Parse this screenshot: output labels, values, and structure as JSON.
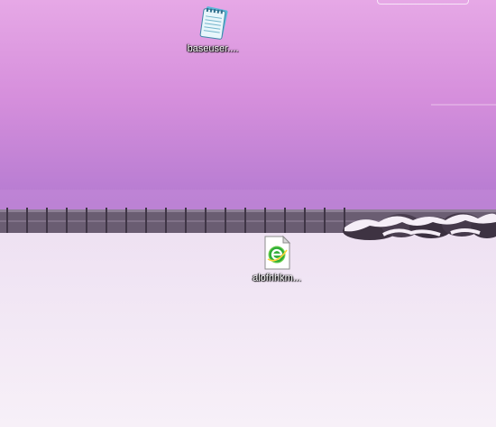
{
  "desktop": {
    "icons": [
      {
        "label": "baseuser....",
        "icon": "notepad-file-icon"
      },
      {
        "label": "alofhhkm...",
        "icon": "html-document-icon"
      }
    ]
  },
  "colors": {
    "sky_top": "#e4a6e4",
    "sky_bottom": "#b778d2",
    "snow": "#f4eaf6",
    "fence": "#5f5366"
  }
}
